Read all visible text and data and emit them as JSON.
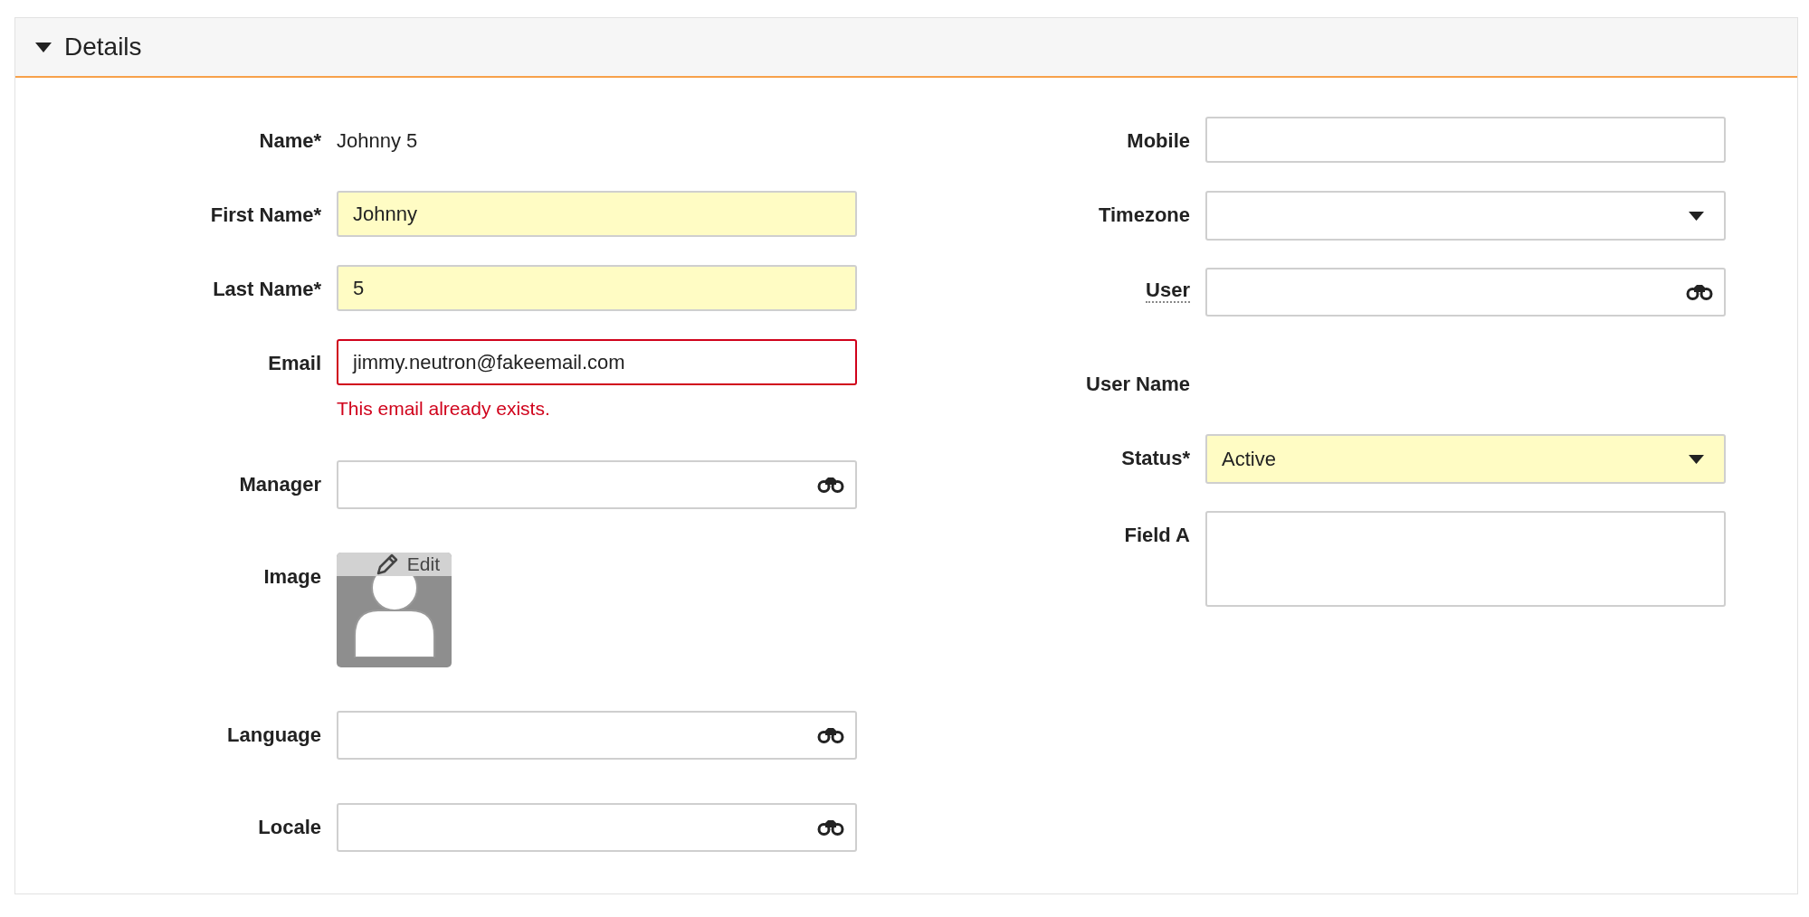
{
  "section": {
    "title": "Details",
    "expanded": true
  },
  "left_fields": [
    {
      "kind": "static",
      "label": "Name*",
      "value": "Johnny 5",
      "tooltip": false
    },
    {
      "kind": "text",
      "label": "First Name*",
      "value": "Johnny",
      "required": true,
      "tooltip": false
    },
    {
      "kind": "text",
      "label": "Last Name*",
      "value": "5",
      "required": true,
      "tooltip": false
    },
    {
      "kind": "text",
      "label": "Email",
      "value": "jimmy.neutron@fakeemail.com",
      "required": false,
      "tooltip": false,
      "error": "This email already exists."
    },
    {
      "kind": "lookup",
      "label": "Manager",
      "required": false,
      "tooltip": false
    },
    {
      "kind": "image",
      "label": "Image",
      "button": "Edit",
      "tooltip": false
    },
    {
      "kind": "lookup",
      "label": "Language",
      "required": false,
      "tooltip": false
    },
    {
      "kind": "lookup",
      "label": "Locale",
      "required": false,
      "tooltip": false
    }
  ],
  "right_fields": [
    {
      "kind": "text",
      "label": "Mobile",
      "required": false,
      "tooltip": false
    },
    {
      "kind": "select",
      "label": "Timezone",
      "required": false,
      "tooltip": false
    },
    {
      "kind": "lookup",
      "label": "User",
      "required": false,
      "tooltip": true
    },
    {
      "kind": "static",
      "label": "User Name",
      "tooltip": false
    },
    {
      "kind": "select",
      "label": "Status*",
      "value": "Active",
      "required": true,
      "tooltip": false
    },
    {
      "kind": "textarea",
      "label": "Field A",
      "required": false,
      "tooltip": false
    }
  ]
}
